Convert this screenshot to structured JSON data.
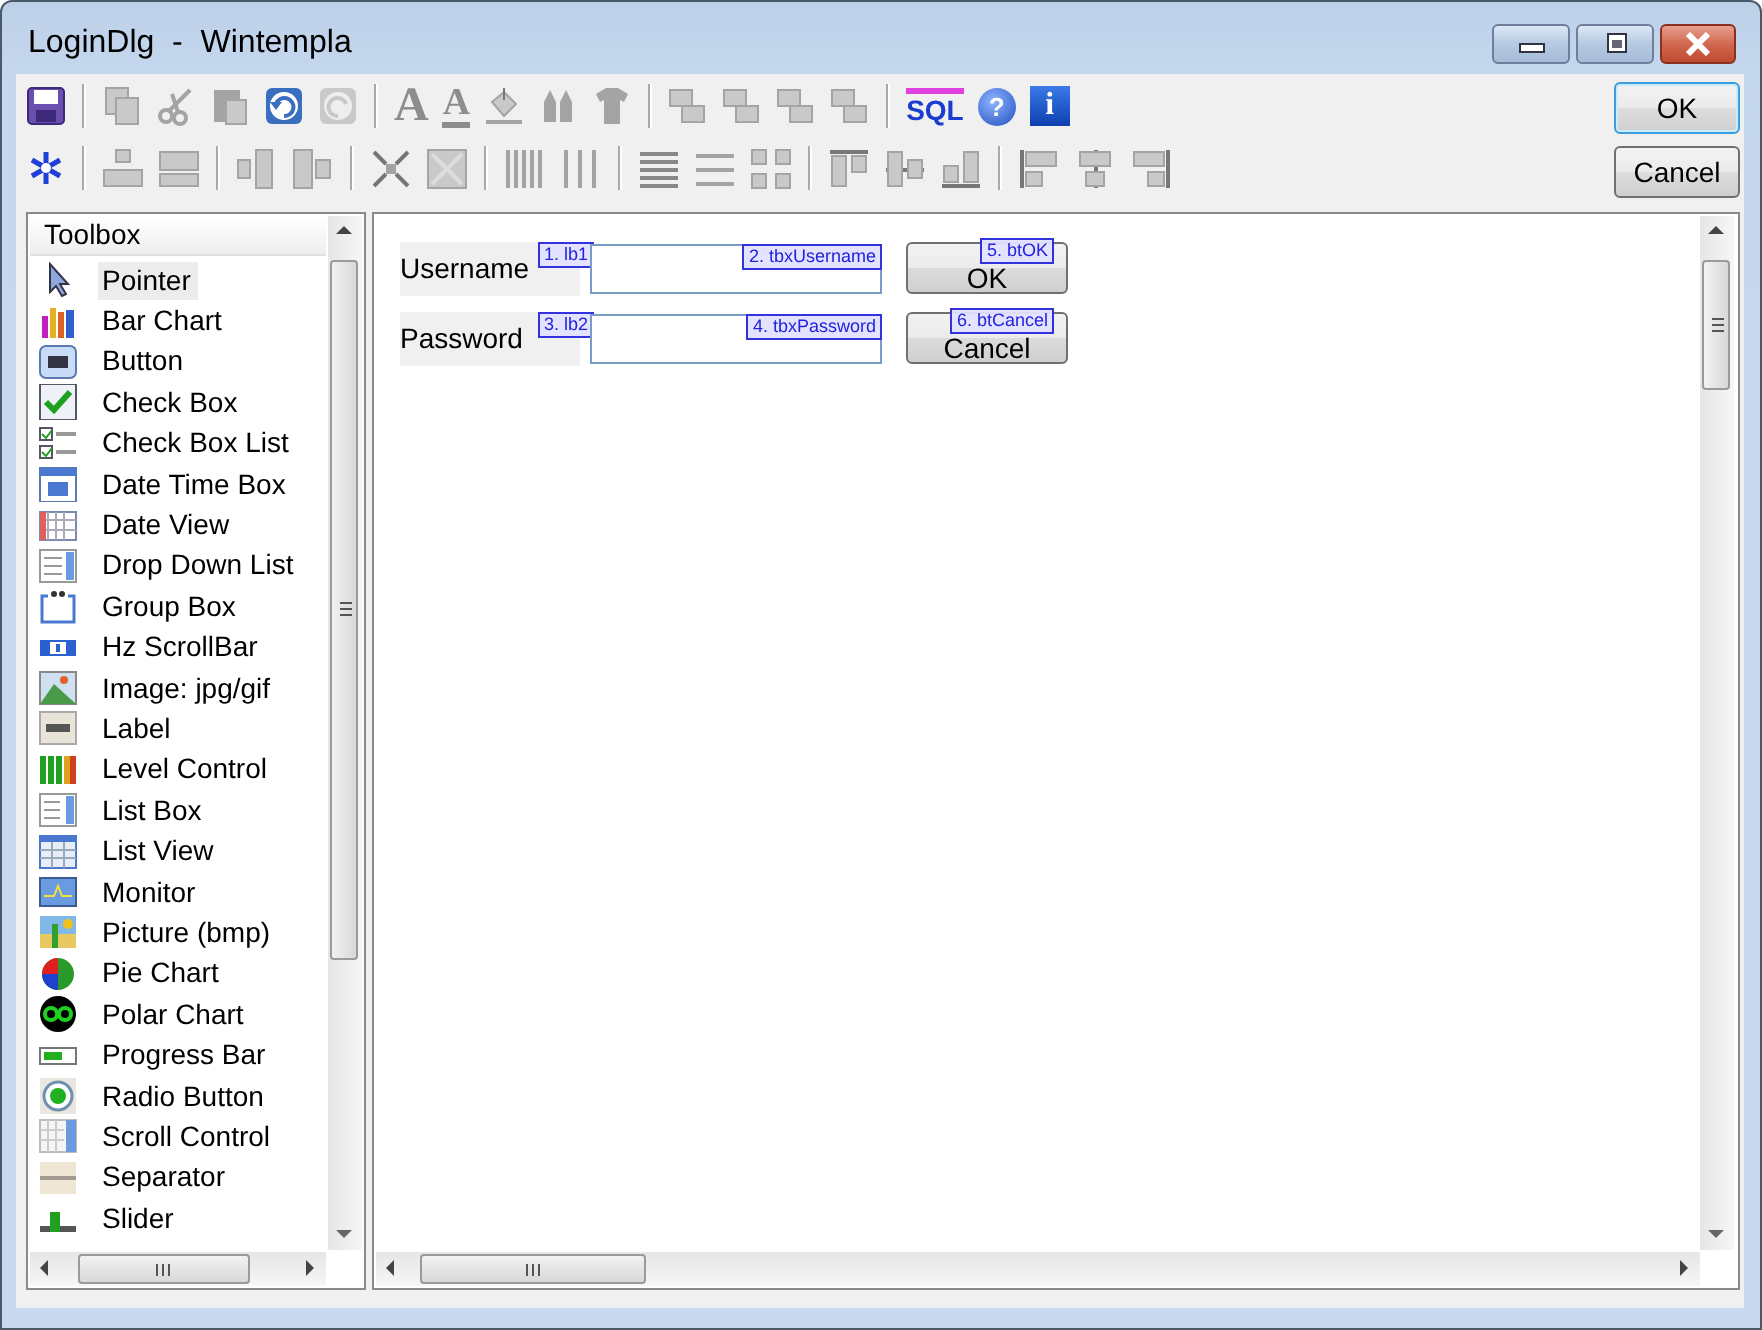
{
  "window": {
    "title": "LoginDlg  -  Wintempla"
  },
  "toolbar": {
    "glyphs": {
      "bold_letter": "A",
      "underline_letter": "A",
      "sql": "SQL",
      "help": "?",
      "info": "i"
    }
  },
  "dialog_buttons": [
    {
      "label": "OK",
      "focused": true
    },
    {
      "label": "Cancel",
      "focused": false
    }
  ],
  "toolbox": {
    "title": "Toolbox",
    "items": [
      {
        "label": "Pointer",
        "selected": true
      },
      {
        "label": "Bar Chart",
        "selected": false
      },
      {
        "label": "Button",
        "selected": false
      },
      {
        "label": "Check Box",
        "selected": false
      },
      {
        "label": "Check Box List",
        "selected": false
      },
      {
        "label": "Date Time Box",
        "selected": false
      },
      {
        "label": "Date View",
        "selected": false
      },
      {
        "label": "Drop Down List",
        "selected": false
      },
      {
        "label": "Group Box",
        "selected": false
      },
      {
        "label": "Hz ScrollBar",
        "selected": false
      },
      {
        "label": "Image: jpg/gif",
        "selected": false
      },
      {
        "label": "Label",
        "selected": false
      },
      {
        "label": "Level Control",
        "selected": false
      },
      {
        "label": "List Box",
        "selected": false
      },
      {
        "label": "List View",
        "selected": false
      },
      {
        "label": "Monitor",
        "selected": false
      },
      {
        "label": "Picture (bmp)",
        "selected": false
      },
      {
        "label": "Pie Chart",
        "selected": false
      },
      {
        "label": "Polar Chart",
        "selected": false
      },
      {
        "label": "Progress Bar",
        "selected": false
      },
      {
        "label": "Radio Button",
        "selected": false
      },
      {
        "label": "Scroll Control",
        "selected": false
      },
      {
        "label": "Separator",
        "selected": false
      },
      {
        "label": "Slider",
        "selected": false
      }
    ]
  },
  "design_form": {
    "rows": [
      [
        {
          "kind": "label",
          "text": "Username",
          "tag": "1. lb1"
        },
        {
          "kind": "textbox",
          "tag": "2. tbxUsername"
        },
        {
          "kind": "button",
          "text": "OK",
          "tag": "5. btOK"
        }
      ],
      [
        {
          "kind": "label",
          "text": "Password",
          "tag": "3. lb2"
        },
        {
          "kind": "textbox",
          "tag": "4. tbxPassword"
        },
        {
          "kind": "button",
          "text": "Cancel",
          "tag": "6. btCancel"
        }
      ]
    ]
  }
}
